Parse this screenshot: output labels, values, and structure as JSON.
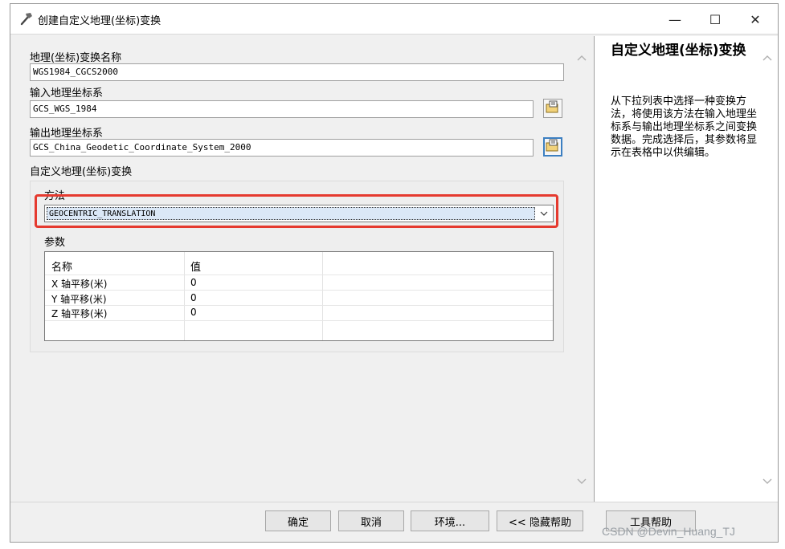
{
  "window": {
    "title": "创建自定义地理(坐标)变换",
    "icon": "hammer-icon",
    "controls": {
      "minimize": "—",
      "maximize": "☐",
      "close": "✕"
    }
  },
  "form": {
    "name_label": "地理(坐标)变换名称",
    "name_value": "WGS1984_CGCS2000",
    "input_label": "输入地理坐标系",
    "input_value": "GCS_WGS_1984",
    "output_label": "输出地理坐标系",
    "output_value": "GCS_China_Geodetic_Coordinate_System_2000",
    "custom_section_label": "自定义地理(坐标)变换",
    "browse_icon": "folder-browse-icon",
    "method": {
      "label": "方法",
      "value": "GEOCENTRIC_TRANSLATION"
    },
    "params": {
      "label": "参数",
      "headers": [
        "名称",
        "值"
      ],
      "rows": [
        {
          "name": "X 轴平移(米)",
          "value": "0"
        },
        {
          "name": "Y 轴平移(米)",
          "value": "0"
        },
        {
          "name": "Z 轴平移(米)",
          "value": "0"
        }
      ]
    }
  },
  "help": {
    "title": "自定义地理(坐标)变换",
    "body": "从下拉列表中选择一种变换方法，将使用该方法在输入地理坐标系与输出地理坐标系之间变换数据。完成选择后，其参数将显示在表格中以供编辑。"
  },
  "buttons": {
    "ok": "确定",
    "cancel": "取消",
    "env": "环境...",
    "hide_help": "<< 隐藏帮助",
    "tool_help": "工具帮助"
  },
  "watermark": "CSDN @Devin_Huang_TJ",
  "colors": {
    "highlight_border": "#e53a2f",
    "focus_border": "#3c7fc1"
  }
}
